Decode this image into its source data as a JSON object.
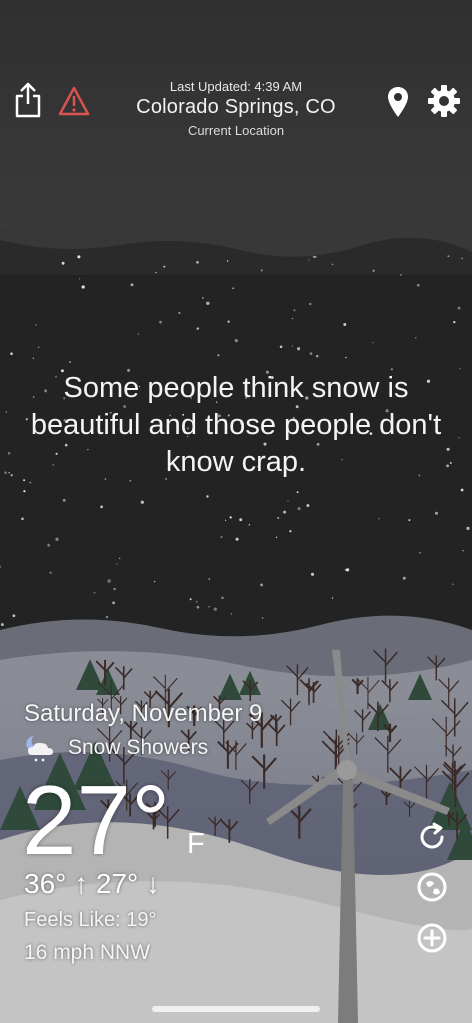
{
  "header": {
    "last_updated": "Last Updated: 4:39 AM",
    "location": "Colorado Springs, CO",
    "location_type": "Current Location"
  },
  "quote": "Some people think snow is beautiful and those people don't know crap.",
  "weather": {
    "date": "Saturday, November 9",
    "condition": "Snow Showers",
    "condition_icon": "partly-cloudy-night-snow-icon",
    "temperature": "27°",
    "unit": "F",
    "high": "36°",
    "low": "27°",
    "feels_like": "Feels Like: 19°",
    "wind": "16 mph NNW"
  },
  "icons": {
    "share": "share-icon",
    "alert": "alert-triangle-icon",
    "location": "location-pin-icon",
    "settings": "gear-icon",
    "refresh": "refresh-icon",
    "radar": "radar-icon",
    "add": "add-circle-icon"
  },
  "colors": {
    "alert": "#d9534f",
    "sky_top": "#2e2e2e",
    "sky_night": "#222222",
    "snow_ground": "#bdbdbd"
  }
}
